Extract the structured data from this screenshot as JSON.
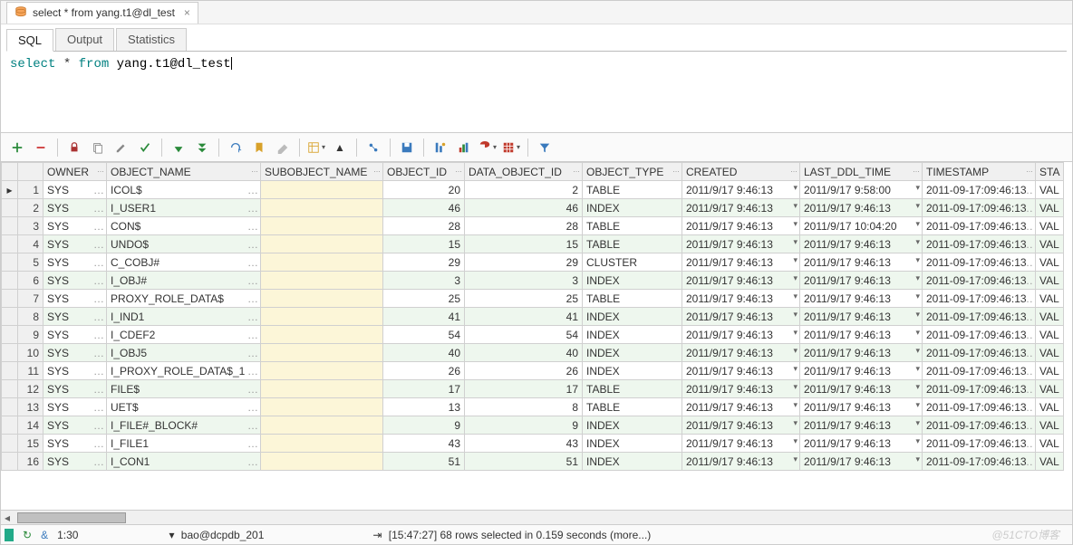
{
  "titleTab": {
    "label": "select * from yang.t1@dl_test"
  },
  "tabs": {
    "sql": "SQL",
    "output": "Output",
    "statistics": "Statistics"
  },
  "sql": {
    "kw_select": "select",
    "star": " * ",
    "kw_from": "from",
    "ident": " yang.t1@dl_test"
  },
  "grid": {
    "columns": [
      "OWNER",
      "OBJECT_NAME",
      "SUBOBJECT_NAME",
      "OBJECT_ID",
      "DATA_OBJECT_ID",
      "OBJECT_TYPE",
      "CREATED",
      "LAST_DDL_TIME",
      "TIMESTAMP",
      "STA"
    ],
    "rows": [
      {
        "n": 1,
        "owner": "SYS",
        "obj": "ICOL$",
        "sub": "",
        "oid": "20",
        "doid": "2",
        "otype": "TABLE",
        "cr": "2011/9/17 9:46:13",
        "ddl": "2011/9/17 9:58:00",
        "ts": "2011-09-17:09:46:13",
        "st": "VAL"
      },
      {
        "n": 2,
        "owner": "SYS",
        "obj": "I_USER1",
        "sub": "",
        "oid": "46",
        "doid": "46",
        "otype": "INDEX",
        "cr": "2011/9/17 9:46:13",
        "ddl": "2011/9/17 9:46:13",
        "ts": "2011-09-17:09:46:13",
        "st": "VAL"
      },
      {
        "n": 3,
        "owner": "SYS",
        "obj": "CON$",
        "sub": "",
        "oid": "28",
        "doid": "28",
        "otype": "TABLE",
        "cr": "2011/9/17 9:46:13",
        "ddl": "2011/9/17 10:04:20",
        "ts": "2011-09-17:09:46:13",
        "st": "VAL"
      },
      {
        "n": 4,
        "owner": "SYS",
        "obj": "UNDO$",
        "sub": "",
        "oid": "15",
        "doid": "15",
        "otype": "TABLE",
        "cr": "2011/9/17 9:46:13",
        "ddl": "2011/9/17 9:46:13",
        "ts": "2011-09-17:09:46:13",
        "st": "VAL"
      },
      {
        "n": 5,
        "owner": "SYS",
        "obj": "C_COBJ#",
        "sub": "",
        "oid": "29",
        "doid": "29",
        "otype": "CLUSTER",
        "cr": "2011/9/17 9:46:13",
        "ddl": "2011/9/17 9:46:13",
        "ts": "2011-09-17:09:46:13",
        "st": "VAL"
      },
      {
        "n": 6,
        "owner": "SYS",
        "obj": "I_OBJ#",
        "sub": "",
        "oid": "3",
        "doid": "3",
        "otype": "INDEX",
        "cr": "2011/9/17 9:46:13",
        "ddl": "2011/9/17 9:46:13",
        "ts": "2011-09-17:09:46:13",
        "st": "VAL"
      },
      {
        "n": 7,
        "owner": "SYS",
        "obj": "PROXY_ROLE_DATA$",
        "sub": "",
        "oid": "25",
        "doid": "25",
        "otype": "TABLE",
        "cr": "2011/9/17 9:46:13",
        "ddl": "2011/9/17 9:46:13",
        "ts": "2011-09-17:09:46:13",
        "st": "VAL"
      },
      {
        "n": 8,
        "owner": "SYS",
        "obj": "I_IND1",
        "sub": "",
        "oid": "41",
        "doid": "41",
        "otype": "INDEX",
        "cr": "2011/9/17 9:46:13",
        "ddl": "2011/9/17 9:46:13",
        "ts": "2011-09-17:09:46:13",
        "st": "VAL"
      },
      {
        "n": 9,
        "owner": "SYS",
        "obj": "I_CDEF2",
        "sub": "",
        "oid": "54",
        "doid": "54",
        "otype": "INDEX",
        "cr": "2011/9/17 9:46:13",
        "ddl": "2011/9/17 9:46:13",
        "ts": "2011-09-17:09:46:13",
        "st": "VAL"
      },
      {
        "n": 10,
        "owner": "SYS",
        "obj": "I_OBJ5",
        "sub": "",
        "oid": "40",
        "doid": "40",
        "otype": "INDEX",
        "cr": "2011/9/17 9:46:13",
        "ddl": "2011/9/17 9:46:13",
        "ts": "2011-09-17:09:46:13",
        "st": "VAL"
      },
      {
        "n": 11,
        "owner": "SYS",
        "obj": "I_PROXY_ROLE_DATA$_1",
        "sub": "",
        "oid": "26",
        "doid": "26",
        "otype": "INDEX",
        "cr": "2011/9/17 9:46:13",
        "ddl": "2011/9/17 9:46:13",
        "ts": "2011-09-17:09:46:13",
        "st": "VAL"
      },
      {
        "n": 12,
        "owner": "SYS",
        "obj": "FILE$",
        "sub": "",
        "oid": "17",
        "doid": "17",
        "otype": "TABLE",
        "cr": "2011/9/17 9:46:13",
        "ddl": "2011/9/17 9:46:13",
        "ts": "2011-09-17:09:46:13",
        "st": "VAL"
      },
      {
        "n": 13,
        "owner": "SYS",
        "obj": "UET$",
        "sub": "",
        "oid": "13",
        "doid": "8",
        "otype": "TABLE",
        "cr": "2011/9/17 9:46:13",
        "ddl": "2011/9/17 9:46:13",
        "ts": "2011-09-17:09:46:13",
        "st": "VAL"
      },
      {
        "n": 14,
        "owner": "SYS",
        "obj": "I_FILE#_BLOCK#",
        "sub": "",
        "oid": "9",
        "doid": "9",
        "otype": "INDEX",
        "cr": "2011/9/17 9:46:13",
        "ddl": "2011/9/17 9:46:13",
        "ts": "2011-09-17:09:46:13",
        "st": "VAL"
      },
      {
        "n": 15,
        "owner": "SYS",
        "obj": "I_FILE1",
        "sub": "",
        "oid": "43",
        "doid": "43",
        "otype": "INDEX",
        "cr": "2011/9/17 9:46:13",
        "ddl": "2011/9/17 9:46:13",
        "ts": "2011-09-17:09:46:13",
        "st": "VAL"
      },
      {
        "n": 16,
        "owner": "SYS",
        "obj": "I_CON1",
        "sub": "",
        "oid": "51",
        "doid": "51",
        "otype": "INDEX",
        "cr": "2011/9/17 9:46:13",
        "ddl": "2011/9/17 9:46:13",
        "ts": "2011-09-17:09:46:13",
        "st": "VAL"
      }
    ]
  },
  "status": {
    "user_icon": "&",
    "cursor": "1:30",
    "conn": "bao@dcpdb_201",
    "msg": "[15:47:27]  68 rows selected in 0.159 seconds (more...)",
    "watermark": "@51CTO博客"
  }
}
